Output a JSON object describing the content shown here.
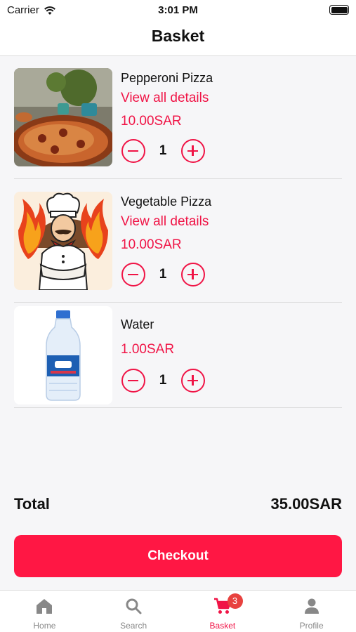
{
  "status_bar": {
    "carrier": "Carrier",
    "time": "3:01 PM"
  },
  "header": {
    "title": "Basket"
  },
  "items": [
    {
      "name": "Pepperoni Pizza",
      "details_link": "View all details",
      "price": "10.00SAR",
      "quantity": "1",
      "image_icon": "pizza-photo"
    },
    {
      "name": "Vegetable Pizza",
      "details_link": "View all details",
      "price": "10.00SAR",
      "quantity": "1",
      "image_icon": "chef-logo"
    },
    {
      "name": "Water",
      "price": "1.00SAR",
      "quantity": "1",
      "image_icon": "water-bottle-photo"
    }
  ],
  "summary": {
    "total_label": "Total",
    "total_value": "35.00SAR"
  },
  "checkout": {
    "label": "Checkout"
  },
  "tabbar": {
    "home": "Home",
    "search": "Search",
    "basket": "Basket",
    "basket_badge": "3",
    "profile": "Profile"
  },
  "colors": {
    "accent": "#f01446",
    "checkout": "#ff1744",
    "badge": "#e8423f",
    "inactive_tab": "#888888"
  }
}
